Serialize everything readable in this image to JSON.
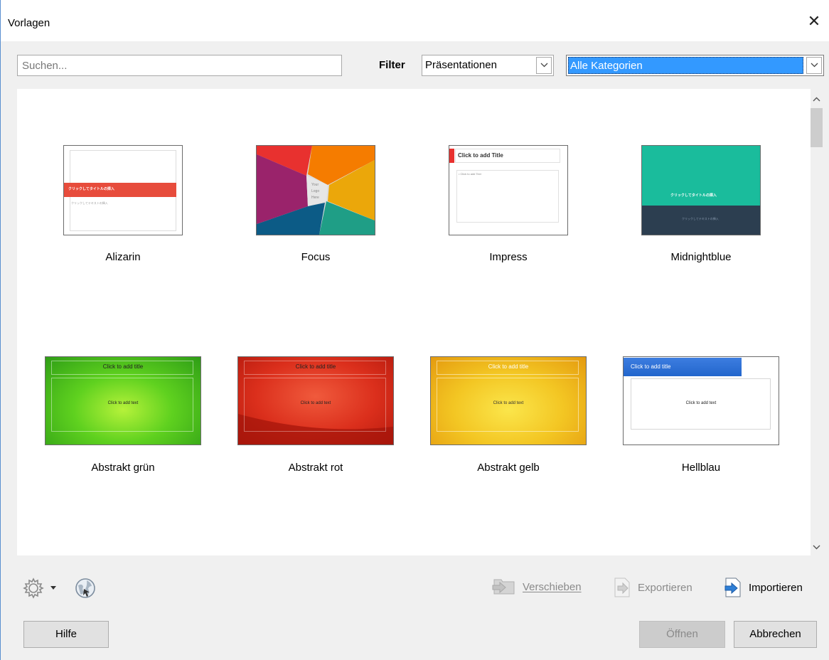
{
  "window": {
    "title": "Vorlagen",
    "close_glyph": "✕"
  },
  "search": {
    "placeholder": "Suchen..."
  },
  "filter": {
    "label": "Filter",
    "type_value": "Präsentationen",
    "category_value": "Alle Kategorien"
  },
  "templates": [
    {
      "name": "Alizarin",
      "thumb": {
        "bar_text": "クリックしてタイトルの挿入",
        "body_text": "クリックしてテキストの挿入"
      }
    },
    {
      "name": "Focus",
      "thumb": {
        "logo_text_1": "Your",
        "logo_text_2": "Logo",
        "logo_text_3": "Here"
      }
    },
    {
      "name": "Impress",
      "thumb": {
        "title_text": "Click to add Title",
        "body_text": "• Click to add Text"
      }
    },
    {
      "name": "Midnightblue",
      "thumb": {
        "title_text": "クリックしてタイトルの挿入",
        "body_text": "クリックしてテキストの挿入"
      }
    },
    {
      "name": "Abstrakt grün",
      "thumb": {
        "title_text": "Click to add title",
        "body_text": "Click to add text"
      }
    },
    {
      "name": "Abstrakt rot",
      "thumb": {
        "title_text": "Click to add title",
        "body_text": "Click to add text"
      }
    },
    {
      "name": "Abstrakt gelb",
      "thumb": {
        "title_text": "Click to add title",
        "body_text": "Click to add text"
      }
    },
    {
      "name": "Hellblau",
      "thumb": {
        "title_text": "Click to add title",
        "body_text": "Click to add text"
      }
    }
  ],
  "toolbar": {
    "move_label": "Verschieben",
    "export_label": "Exportieren",
    "import_label": "Importieren"
  },
  "buttons": {
    "help": "Hilfe",
    "open": "Öffnen",
    "cancel": "Abbrechen"
  },
  "colors": {
    "accent_selection": "#3399ff",
    "alizarin_red": "#e74c3c",
    "midnight_teal": "#1abc9c",
    "midnight_dark": "#2c3e50"
  }
}
